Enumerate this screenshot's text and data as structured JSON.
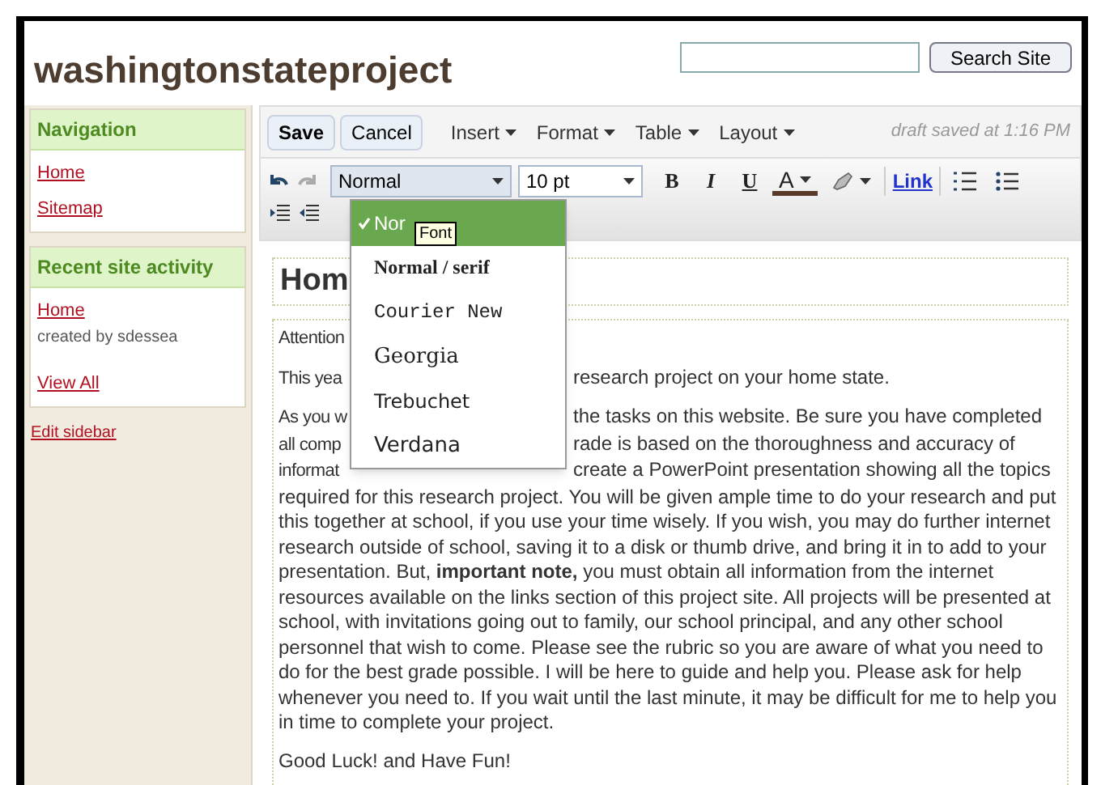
{
  "site_title": "washingtonstateproject",
  "search": {
    "button": "Search Site"
  },
  "sidebar": {
    "sections": [
      {
        "title": "Navigation",
        "items": [
          {
            "label": "Home"
          },
          {
            "label": "Sitemap"
          }
        ]
      },
      {
        "title": "Recent site activity",
        "items": [
          {
            "label": "Home",
            "note": "created by sdessea"
          },
          {
            "label": "View All"
          }
        ]
      }
    ],
    "edit_link": "Edit sidebar"
  },
  "editor": {
    "actions": [
      "Save",
      "Cancel"
    ],
    "menus": [
      "Insert",
      "Format",
      "Table",
      "Layout"
    ],
    "status": "draft saved at 1:16 PM",
    "style_select": "Normal",
    "size_select": "10 pt",
    "format_buttons": [
      {
        "kind": "bold",
        "label": "B"
      },
      {
        "kind": "italic",
        "label": "I"
      },
      {
        "kind": "underline",
        "label": "U"
      },
      {
        "kind": "color",
        "label": "A"
      },
      {
        "kind": "highlight"
      },
      {
        "kind": "link",
        "label": "Link"
      },
      {
        "kind": "numbered-list"
      },
      {
        "kind": "bullet-list"
      }
    ],
    "font_menu": {
      "items": [
        {
          "label": "Nor",
          "kind": "sans",
          "selected": true
        },
        {
          "label": "Normal / serif",
          "kind": "serif",
          "selected": false
        },
        {
          "label": "Courier New",
          "kind": "mono",
          "selected": false
        },
        {
          "label": "Georgia",
          "kind": "georgia",
          "selected": false
        },
        {
          "label": "Trebuchet",
          "kind": "trebuchet",
          "selected": false
        },
        {
          "label": "Verdana",
          "kind": "verdana",
          "selected": false
        }
      ],
      "tooltip": "Font"
    }
  },
  "page": {
    "title": "Hom",
    "lines": [
      {
        "left": "Attention"
      },
      {
        "left": "This yea",
        "right": "research project on your home state."
      },
      {
        "left": "As you w",
        "right": "the tasks on this website. Be sure you have completed"
      },
      {
        "left": "all comp",
        "right": "rade is based on the thoroughness and accuracy of"
      },
      {
        "left": "informat",
        "right": "create a PowerPoint presentation showing all the topics"
      }
    ],
    "body": "required for this research project. You will be given ample time to do your research and put this together at school, if you use your time wisely. If you wish, you may do further internet research outside of school, saving it to a disk or thumb drive, and bring it in to add to your presentation. But, **important note,** you must obtain all information from the internet resources available on the links section of this project site. All projects will be presented at school, with invitations going out to family, our school principal, and any other school personnel that wish to come. Please see the rubric so you are aware of what you need to do for the best grade possible. I will be here to guide and help you. Please ask for help whenever you need to. If you wait until the last minute, it may be difficult for me to help you in time to complete your project.",
    "closing": "Good Luck! and Have Fun!"
  }
}
